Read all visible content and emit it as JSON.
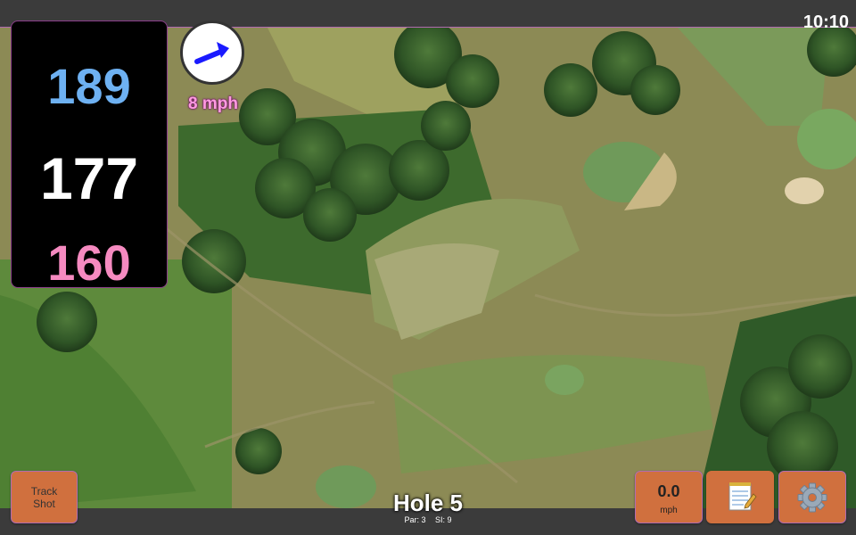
{
  "status": {
    "time": "10:10"
  },
  "distances": {
    "back": "189",
    "middle": "177",
    "front": "160"
  },
  "wind": {
    "direction_icon": "wind-arrow-icon",
    "speed_label": "8 mph"
  },
  "buttons": {
    "track_shot_line1": "Track",
    "track_shot_line2": "Shot",
    "wind_value": "0.0",
    "wind_unit": "mph",
    "notes_icon": "notepad-icon",
    "settings_icon": "gear-icon"
  },
  "hole": {
    "title": "Hole 5",
    "par_label": "Par: 3",
    "si_label": "SI: 9"
  },
  "colors": {
    "back_distance": "#6eb1f2",
    "middle_distance": "#ffffff",
    "front_distance": "#f58ac0",
    "button": "#d0703e",
    "accent_border": "#b26bb0"
  }
}
